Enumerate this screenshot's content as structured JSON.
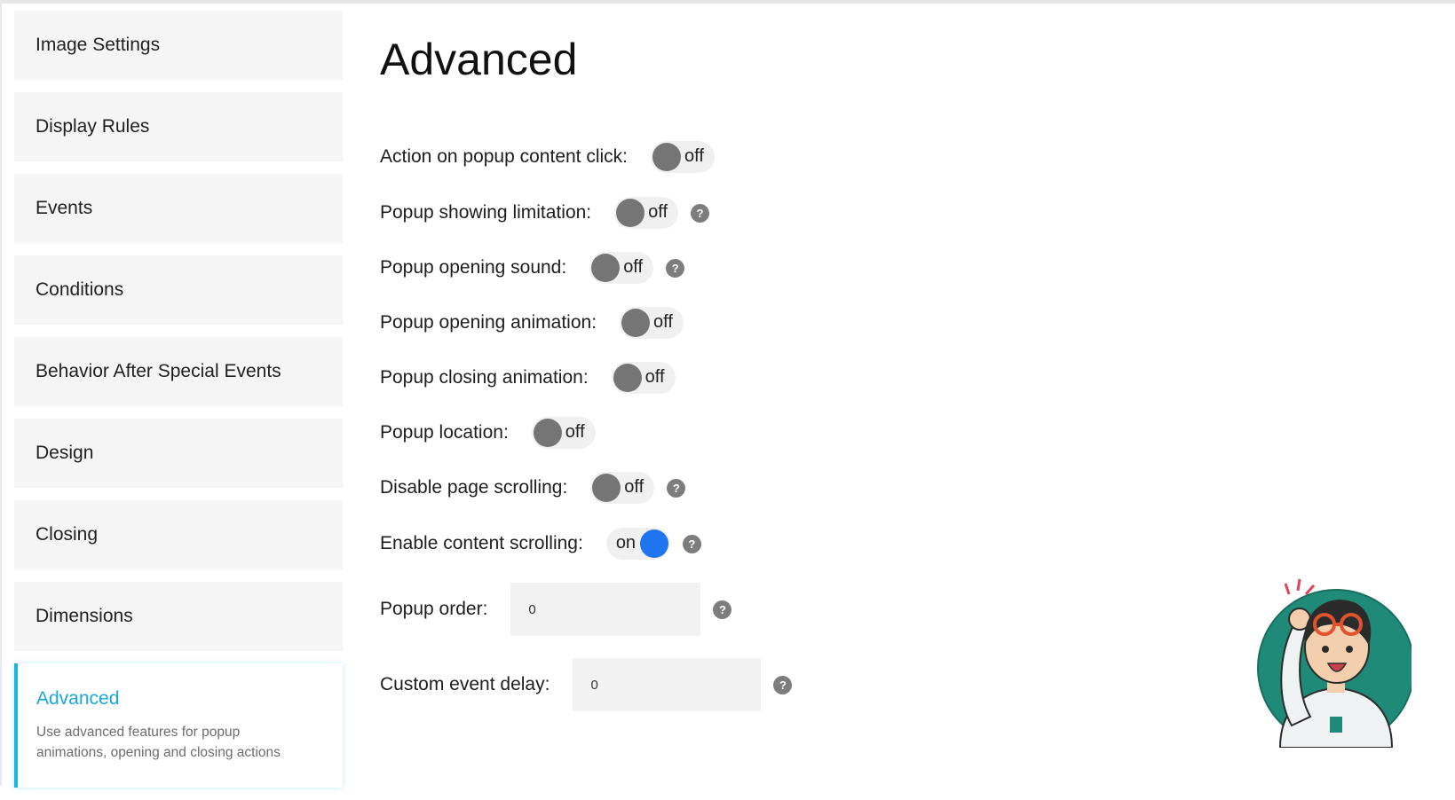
{
  "sidebar": {
    "items": [
      {
        "label": "Image Settings"
      },
      {
        "label": "Display Rules"
      },
      {
        "label": "Events"
      },
      {
        "label": "Conditions"
      },
      {
        "label": "Behavior After Special Events"
      },
      {
        "label": "Design"
      },
      {
        "label": "Closing"
      },
      {
        "label": "Dimensions"
      }
    ],
    "active": {
      "label": "Advanced",
      "description": "Use advanced features for popup animations, opening and closing actions"
    }
  },
  "main": {
    "title": "Advanced",
    "settings": [
      {
        "label": "Action on popup content click:",
        "state": "off"
      },
      {
        "label": "Popup showing limitation:",
        "state": "off"
      },
      {
        "label": "Popup opening sound:",
        "state": "off"
      },
      {
        "label": "Popup opening animation:",
        "state": "off"
      },
      {
        "label": "Popup closing animation:",
        "state": "off"
      },
      {
        "label": "Popup location:",
        "state": "off"
      },
      {
        "label": "Disable page scrolling:",
        "state": "off"
      },
      {
        "label": "Enable content scrolling:",
        "state": "on"
      }
    ],
    "popup_order": {
      "label": "Popup order:",
      "value": "0"
    },
    "custom_event_delay": {
      "label": "Custom event delay:",
      "value": "0"
    },
    "help_glyph": "?"
  },
  "colors": {
    "accent": "#19b5dc",
    "toggle_on": "#1f74f0",
    "toggle_off_knob": "#757575",
    "nav_bg": "#f5f5f5"
  }
}
